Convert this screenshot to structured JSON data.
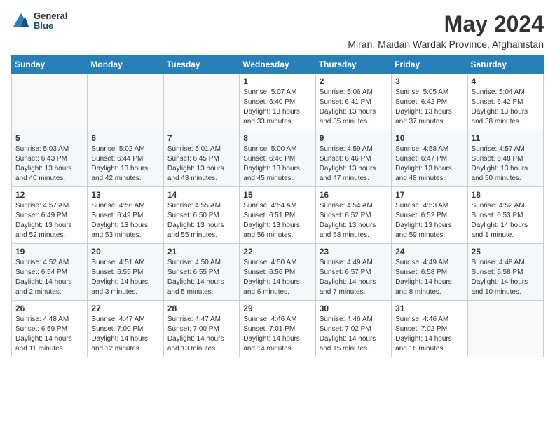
{
  "header": {
    "logo_general": "General",
    "logo_blue": "Blue",
    "month_year": "May 2024",
    "location": "Miran, Maidan Wardak Province, Afghanistan"
  },
  "days_of_week": [
    "Sunday",
    "Monday",
    "Tuesday",
    "Wednesday",
    "Thursday",
    "Friday",
    "Saturday"
  ],
  "weeks": [
    [
      {
        "day": "",
        "info": ""
      },
      {
        "day": "",
        "info": ""
      },
      {
        "day": "",
        "info": ""
      },
      {
        "day": "1",
        "info": "Sunrise: 5:07 AM\nSunset: 6:40 PM\nDaylight: 13 hours and 33 minutes."
      },
      {
        "day": "2",
        "info": "Sunrise: 5:06 AM\nSunset: 6:41 PM\nDaylight: 13 hours and 35 minutes."
      },
      {
        "day": "3",
        "info": "Sunrise: 5:05 AM\nSunset: 6:42 PM\nDaylight: 13 hours and 37 minutes."
      },
      {
        "day": "4",
        "info": "Sunrise: 5:04 AM\nSunset: 6:42 PM\nDaylight: 13 hours and 38 minutes."
      }
    ],
    [
      {
        "day": "5",
        "info": "Sunrise: 5:03 AM\nSunset: 6:43 PM\nDaylight: 13 hours and 40 minutes."
      },
      {
        "day": "6",
        "info": "Sunrise: 5:02 AM\nSunset: 6:44 PM\nDaylight: 13 hours and 42 minutes."
      },
      {
        "day": "7",
        "info": "Sunrise: 5:01 AM\nSunset: 6:45 PM\nDaylight: 13 hours and 43 minutes."
      },
      {
        "day": "8",
        "info": "Sunrise: 5:00 AM\nSunset: 6:46 PM\nDaylight: 13 hours and 45 minutes."
      },
      {
        "day": "9",
        "info": "Sunrise: 4:59 AM\nSunset: 6:46 PM\nDaylight: 13 hours and 47 minutes."
      },
      {
        "day": "10",
        "info": "Sunrise: 4:58 AM\nSunset: 6:47 PM\nDaylight: 13 hours and 48 minutes."
      },
      {
        "day": "11",
        "info": "Sunrise: 4:57 AM\nSunset: 6:48 PM\nDaylight: 13 hours and 50 minutes."
      }
    ],
    [
      {
        "day": "12",
        "info": "Sunrise: 4:57 AM\nSunset: 6:49 PM\nDaylight: 13 hours and 52 minutes."
      },
      {
        "day": "13",
        "info": "Sunrise: 4:56 AM\nSunset: 6:49 PM\nDaylight: 13 hours and 53 minutes."
      },
      {
        "day": "14",
        "info": "Sunrise: 4:55 AM\nSunset: 6:50 PM\nDaylight: 13 hours and 55 minutes."
      },
      {
        "day": "15",
        "info": "Sunrise: 4:54 AM\nSunset: 6:51 PM\nDaylight: 13 hours and 56 minutes."
      },
      {
        "day": "16",
        "info": "Sunrise: 4:54 AM\nSunset: 6:52 PM\nDaylight: 13 hours and 58 minutes."
      },
      {
        "day": "17",
        "info": "Sunrise: 4:53 AM\nSunset: 6:52 PM\nDaylight: 13 hours and 59 minutes."
      },
      {
        "day": "18",
        "info": "Sunrise: 4:52 AM\nSunset: 6:53 PM\nDaylight: 14 hours and 1 minute."
      }
    ],
    [
      {
        "day": "19",
        "info": "Sunrise: 4:52 AM\nSunset: 6:54 PM\nDaylight: 14 hours and 2 minutes."
      },
      {
        "day": "20",
        "info": "Sunrise: 4:51 AM\nSunset: 6:55 PM\nDaylight: 14 hours and 3 minutes."
      },
      {
        "day": "21",
        "info": "Sunrise: 4:50 AM\nSunset: 6:55 PM\nDaylight: 14 hours and 5 minutes."
      },
      {
        "day": "22",
        "info": "Sunrise: 4:50 AM\nSunset: 6:56 PM\nDaylight: 14 hours and 6 minutes."
      },
      {
        "day": "23",
        "info": "Sunrise: 4:49 AM\nSunset: 6:57 PM\nDaylight: 14 hours and 7 minutes."
      },
      {
        "day": "24",
        "info": "Sunrise: 4:49 AM\nSunset: 6:58 PM\nDaylight: 14 hours and 8 minutes."
      },
      {
        "day": "25",
        "info": "Sunrise: 4:48 AM\nSunset: 6:58 PM\nDaylight: 14 hours and 10 minutes."
      }
    ],
    [
      {
        "day": "26",
        "info": "Sunrise: 4:48 AM\nSunset: 6:59 PM\nDaylight: 14 hours and 11 minutes."
      },
      {
        "day": "27",
        "info": "Sunrise: 4:47 AM\nSunset: 7:00 PM\nDaylight: 14 hours and 12 minutes."
      },
      {
        "day": "28",
        "info": "Sunrise: 4:47 AM\nSunset: 7:00 PM\nDaylight: 14 hours and 13 minutes."
      },
      {
        "day": "29",
        "info": "Sunrise: 4:46 AM\nSunset: 7:01 PM\nDaylight: 14 hours and 14 minutes."
      },
      {
        "day": "30",
        "info": "Sunrise: 4:46 AM\nSunset: 7:02 PM\nDaylight: 14 hours and 15 minutes."
      },
      {
        "day": "31",
        "info": "Sunrise: 4:46 AM\nSunset: 7:02 PM\nDaylight: 14 hours and 16 minutes."
      },
      {
        "day": "",
        "info": ""
      }
    ]
  ]
}
